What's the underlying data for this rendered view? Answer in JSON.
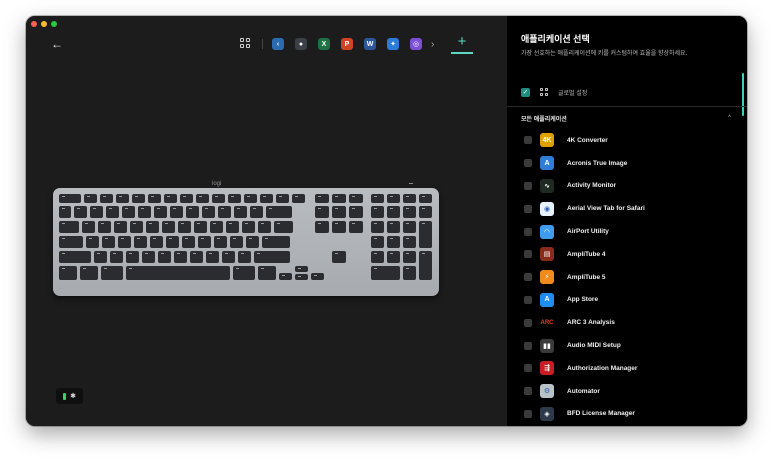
{
  "window": {
    "traffic_lights": [
      "#ff5f57",
      "#febc2e",
      "#28c840"
    ]
  },
  "toolbar": {
    "back_icon": "arrow-left-icon",
    "grid_icon": "app-grid-icon",
    "apps": [
      {
        "icon": "app-icon-1",
        "glyph": "‹",
        "bg": "#2b6cb0"
      },
      {
        "icon": "app-icon-2",
        "glyph": "●",
        "bg": "#3a3f48"
      },
      {
        "icon": "excel-icon",
        "glyph": "X",
        "bg": "#1e7145"
      },
      {
        "icon": "powerpoint-icon",
        "glyph": "P",
        "bg": "#d04423"
      },
      {
        "icon": "word-icon",
        "glyph": "W",
        "bg": "#2b579a"
      },
      {
        "icon": "app-icon-6",
        "glyph": "✦",
        "bg": "#2d7bd6"
      },
      {
        "icon": "app-icon-7",
        "glyph": "◎",
        "bg": "#7b4fd6"
      }
    ],
    "more_icon": "chevron-right-icon",
    "add_label": "+"
  },
  "keyboard": {
    "logo": "logi"
  },
  "device": {
    "battery_color": "#3ccf6b",
    "bluetooth_glyph": "✱"
  },
  "panel": {
    "title": "애플리케이션 선택",
    "subtitle": "가장 선호하는 애플리케이션에 키를 커스텀하여 효율을 향상하세요.",
    "global": {
      "checked_glyph": "✓",
      "label": "글로벌 설정"
    },
    "section": {
      "label": "모든 애플리케이션",
      "caret": "^"
    },
    "apps": [
      {
        "name": "4K Converter",
        "icon": "4k-converter-icon",
        "glyph": "4K",
        "bg": "#e0a100"
      },
      {
        "name": "Acronis True Image",
        "icon": "acronis-icon",
        "glyph": "A",
        "bg": "#2f7dd6"
      },
      {
        "name": "Activity Monitor",
        "icon": "activity-monitor-icon",
        "glyph": "∿",
        "bg": "#1f2a22"
      },
      {
        "name": "Aerial View Tab for Safari",
        "icon": "aerial-view-icon",
        "glyph": "◉",
        "bg": "#e8f1ff"
      },
      {
        "name": "AirPort Utility",
        "icon": "airport-utility-icon",
        "glyph": "◠",
        "bg": "#3f9df0"
      },
      {
        "name": "AmpliTube 4",
        "icon": "amplitube4-icon",
        "glyph": "▤",
        "bg": "#8a2b1b"
      },
      {
        "name": "AmpliTube 5",
        "icon": "amplitube5-icon",
        "glyph": "⚡",
        "bg": "#f08a1c"
      },
      {
        "name": "App Store",
        "icon": "app-store-icon",
        "glyph": "A",
        "bg": "#1e8cf0"
      },
      {
        "name": "ARC 3 Analysis",
        "icon": "arc3-icon",
        "glyph": "ARC",
        "bg": "#000000"
      },
      {
        "name": "Audio MIDI Setup",
        "icon": "audio-midi-icon",
        "glyph": "▮▮",
        "bg": "#3a3a3a"
      },
      {
        "name": "Authorization Manager",
        "icon": "authorization-manager-icon",
        "glyph": "⇶",
        "bg": "#c81d25"
      },
      {
        "name": "Automator",
        "icon": "automator-icon",
        "glyph": "⚙",
        "bg": "#b8c0c8"
      },
      {
        "name": "BFD License Manager",
        "icon": "bfd-license-icon",
        "glyph": "◈",
        "bg": "#2c3a4a"
      }
    ]
  }
}
